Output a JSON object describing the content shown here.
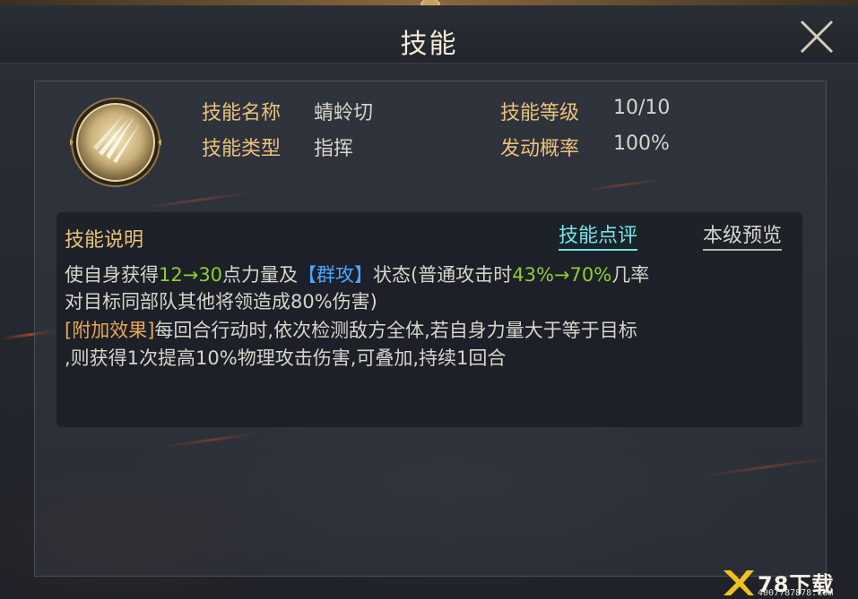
{
  "header": {
    "title": "技能"
  },
  "skill": {
    "name_label": "技能名称",
    "name_value": "蜻蛉切",
    "level_label": "技能等级",
    "level_value": "10/10",
    "type_label": "技能类型",
    "type_value": "指挥",
    "rate_label": "发动概率",
    "rate_value": "100%"
  },
  "description": {
    "title": "技能说明",
    "review_link": "技能点评",
    "preview_link": "本级预览",
    "line1": {
      "a": "使自身获得",
      "b": "12→30",
      "c": "点力量及",
      "d": "【群攻】",
      "e": "状态(普通攻击时",
      "f": "43%→70%",
      "g": "几率"
    },
    "line2": "对目标同部队其他将领造成80%伤害)",
    "line3": {
      "a": "[附加效果]",
      "b": "每回合行动时,依次检测敌方全体,若自身力量大于等于目标"
    },
    "line4": ",则获得1次提高10%物理攻击伤害,可叠加,持续1回合"
  },
  "watermark": {
    "text": "78下载",
    "sub": "4007787878.com"
  },
  "colors": {
    "gold": "#e9c27a",
    "cyan": "#6fe6e6",
    "green": "#8bd02f",
    "blue": "#49a7ff"
  }
}
